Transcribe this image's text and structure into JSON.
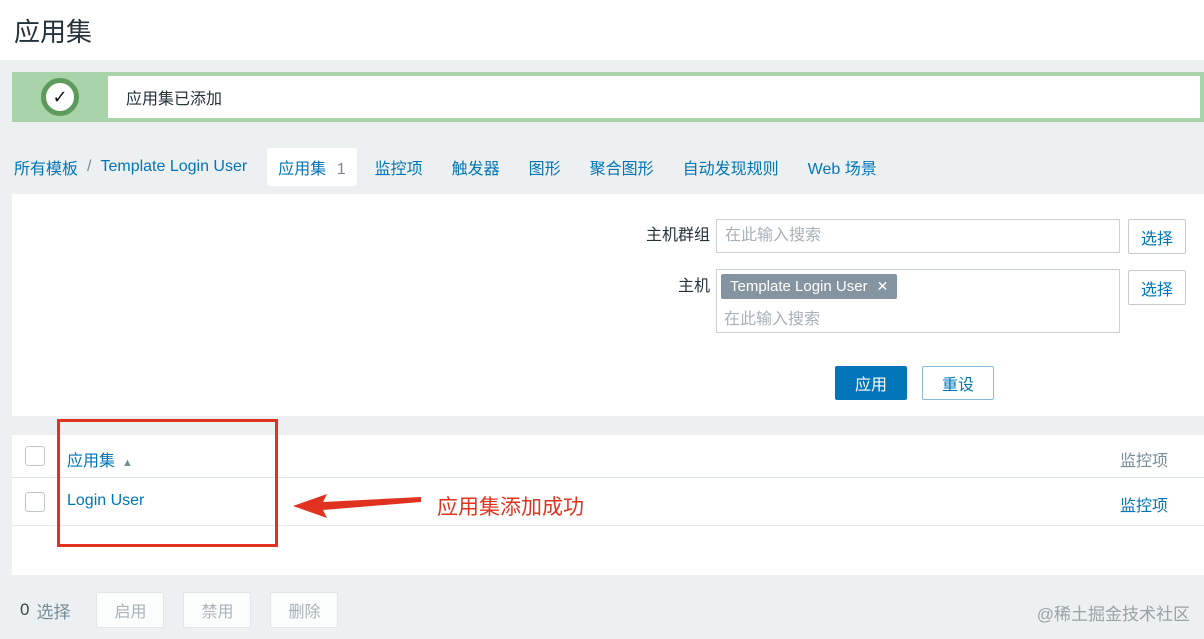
{
  "page": {
    "title": "应用集",
    "watermark": "@稀土掘金技术社区"
  },
  "message": {
    "text": "应用集已添加",
    "check_icon": "✓"
  },
  "nav": {
    "breadcrumb": {
      "all_templates": "所有模板",
      "separator": "/",
      "template_name": "Template Login User"
    },
    "tabs": {
      "applications": {
        "label": "应用集",
        "count": "1"
      },
      "items": "监控项",
      "triggers": "触发器",
      "graphs": "图形",
      "screens": "聚合图形",
      "discovery": "自动发现规则",
      "web": "Web 场景"
    }
  },
  "filter": {
    "host_group_label": "主机群组",
    "host_group_placeholder": "在此输入搜索",
    "host_label": "主机",
    "host_tag": "Template Login User",
    "host_tag_remove_icon": "✕",
    "host_placeholder": "在此输入搜索",
    "select_button": "选择",
    "apply_button": "应用",
    "reset_button": "重设"
  },
  "table": {
    "app_column_header": "应用集",
    "sort_ascending_icon": "▲",
    "items_column_header": "监控项",
    "rows": [
      {
        "application": "Login User",
        "items_link": "监控项"
      }
    ]
  },
  "annotation": {
    "text": "应用集添加成功"
  },
  "footer": {
    "selected_count": "0",
    "selected_label": "选择",
    "enable_button": "启用",
    "disable_button": "禁用",
    "delete_button": "删除"
  },
  "colors": {
    "accent_blue": "#0275b8",
    "success_green": "#a9d3a9",
    "annotation_red": "#e0331f"
  }
}
